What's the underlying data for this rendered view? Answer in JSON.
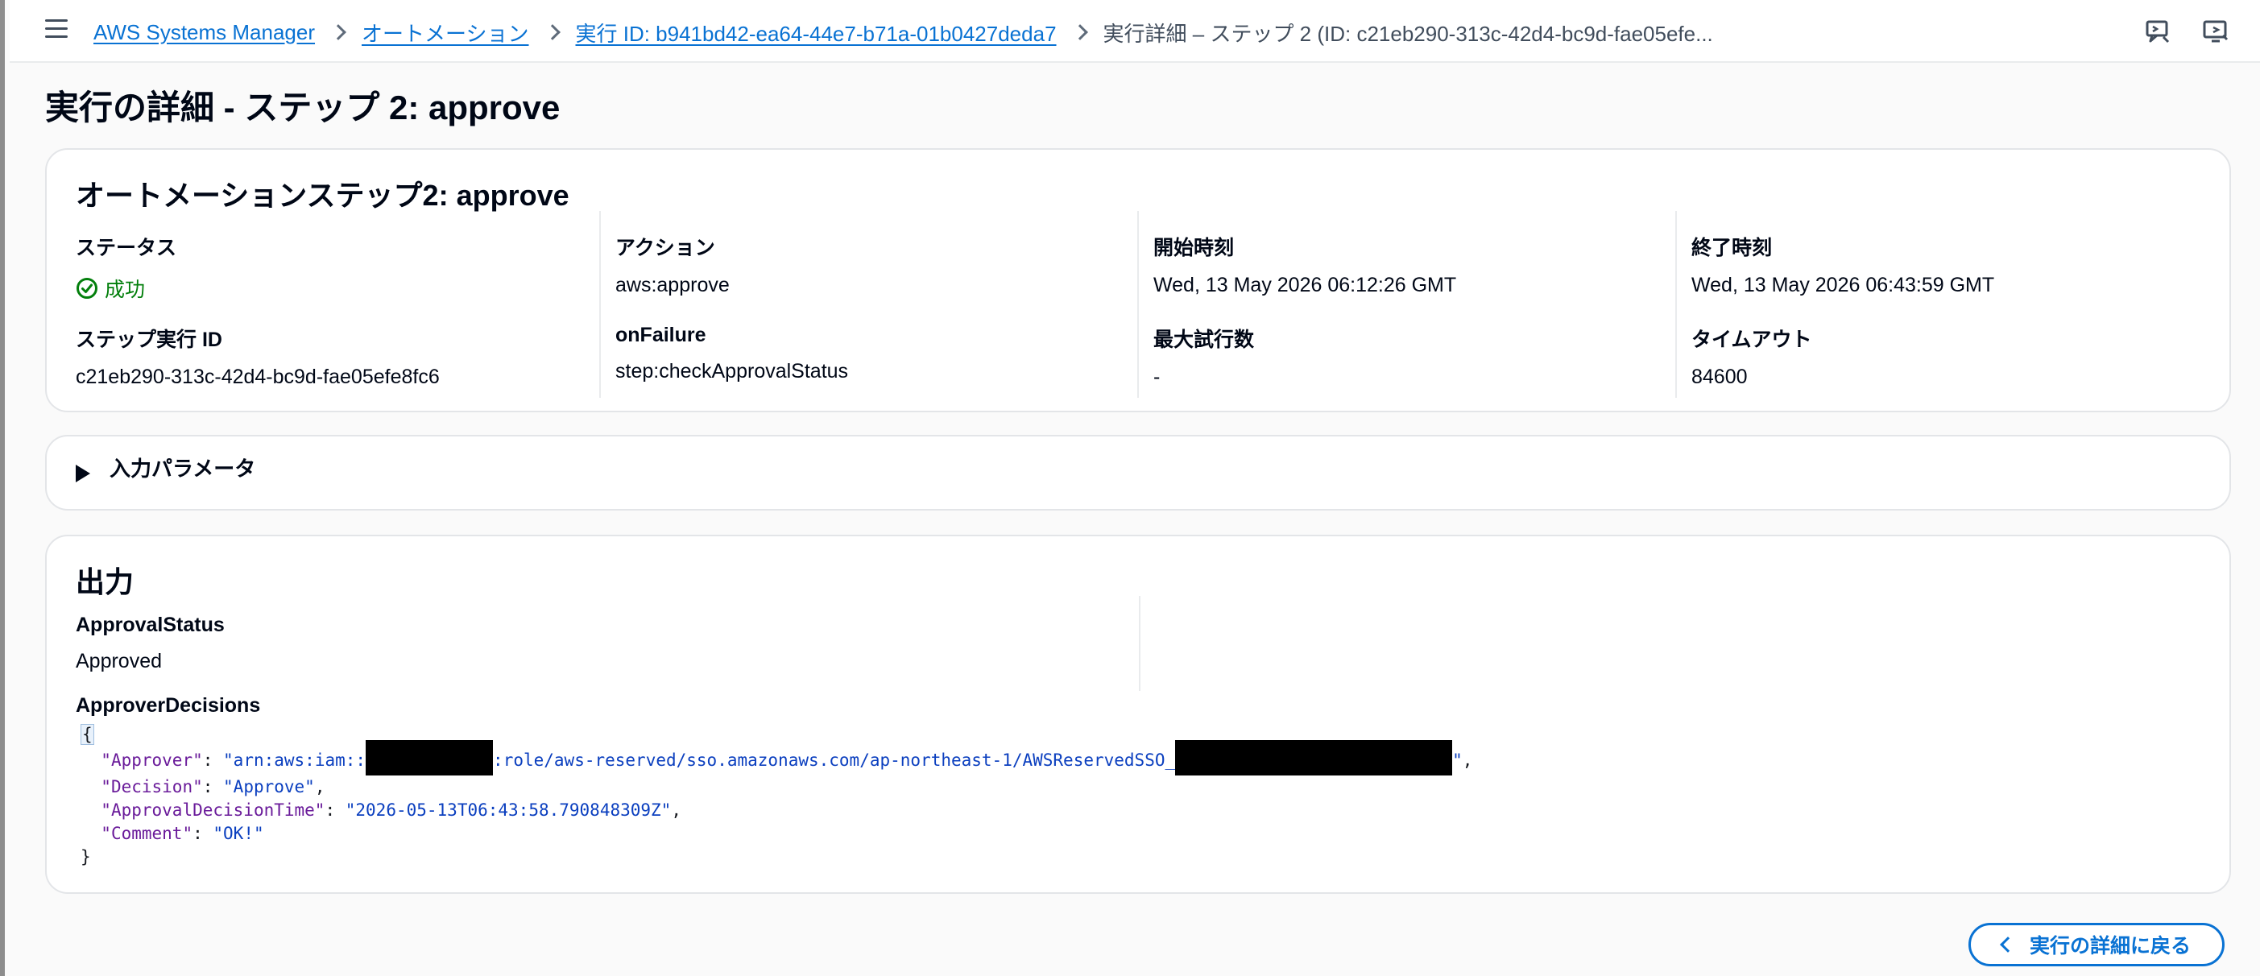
{
  "breadcrumbs": [
    {
      "label": "AWS Systems Manager"
    },
    {
      "label": "オートメーション"
    },
    {
      "label": "実行 ID: b941bd42-ea64-44e7-b71a-01b0427deda7"
    },
    {
      "label": "実行詳細 – ステップ 2 (ID: c21eb290-313c-42d4-bc9d-fae05efe..."
    }
  ],
  "page_title": "実行の詳細 - ステップ 2: approve",
  "summary": {
    "title": "オートメーションステップ2: approve",
    "status_label": "ステータス",
    "status_value": "成功",
    "step_id_label": "ステップ実行 ID",
    "step_id_value": "c21eb290-313c-42d4-bc9d-fae05efe8fc6",
    "action_label": "アクション",
    "action_value": "aws:approve",
    "onfailure_label": "onFailure",
    "onfailure_value": "step:checkApprovalStatus",
    "start_label": "開始時刻",
    "start_value": "Wed, 13 May 2026 06:12:26 GMT",
    "max_attempts_label": "最大試行数",
    "max_attempts_value": "-",
    "end_label": "終了時刻",
    "end_value": "Wed, 13 May 2026 06:43:59 GMT",
    "timeout_label": "タイムアウト",
    "timeout_value": "84600"
  },
  "input_params": {
    "label": "入力パラメータ"
  },
  "output": {
    "title": "出力",
    "approval_status_label": "ApprovalStatus",
    "approval_status_value": "Approved",
    "approver_decisions_label": "ApproverDecisions",
    "code": {
      "open": "{",
      "close": "}",
      "approver_key": "\"Approver\"",
      "approver_prefix": "\"arn:aws:iam::",
      "approver_mid": ":role/aws-reserved/sso.amazonaws.com/ap-northeast-1/AWSReservedSSO_",
      "approver_suffix": "\"",
      "decision_key": "\"Decision\"",
      "decision_value": "\"Approve\"",
      "time_key": "\"ApprovalDecisionTime\"",
      "time_value": "\"2026-05-13T06:43:58.790848309Z\"",
      "comment_key": "\"Comment\"",
      "comment_value": "\"OK!\""
    }
  },
  "back_button_label": "実行の詳細に戻る",
  "colors": {
    "link": "#0972d3",
    "success": "#037f0c",
    "json_key": "#6a1b9a",
    "json_string": "#0b3fbf"
  },
  "icons": [
    "menu-icon",
    "chevron-right-icon",
    "feedback-icon",
    "screen-icon",
    "check-circle-icon",
    "caret-right-icon",
    "chevron-left-icon"
  ]
}
